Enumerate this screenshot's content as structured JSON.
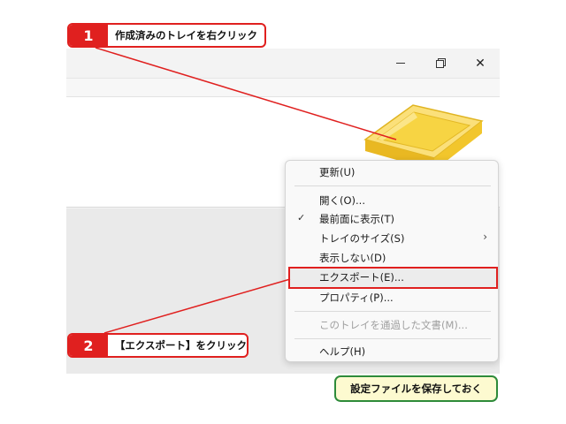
{
  "steps": [
    {
      "number": "1",
      "text": "作成済みのトレイを右クリック"
    },
    {
      "number": "2",
      "text": "【エクスポート】をクリック"
    }
  ],
  "tip": "設定ファイルを保存しておく",
  "window": {
    "controls": [
      "minimize-icon",
      "restore-icon",
      "close-icon"
    ],
    "close_glyph": "✕"
  },
  "context_menu": {
    "items": [
      {
        "label": "更新(U)",
        "enabled": true
      },
      {
        "label": "開く(O)...",
        "enabled": true
      },
      {
        "label": "最前面に表示(T)",
        "enabled": true,
        "checked": true
      },
      {
        "label": "トレイのサイズ(S)",
        "enabled": true,
        "submenu": true
      },
      {
        "label": "表示しない(D)",
        "enabled": true
      },
      {
        "label": "エクスポート(E)...",
        "enabled": true,
        "highlighted": true
      },
      {
        "label": "プロパティ(P)...",
        "enabled": true
      },
      {
        "label": "このトレイを通過した文書(M)...",
        "enabled": false
      },
      {
        "label": "ヘルプ(H)",
        "enabled": true
      }
    ],
    "check_glyph": "✓",
    "arrow_glyph": "›"
  },
  "colors": {
    "accent_red": "#e0201f",
    "tip_border_green": "#2e8b3a",
    "tip_background": "#fdfad0",
    "tray_yellow": "#f7d443"
  }
}
